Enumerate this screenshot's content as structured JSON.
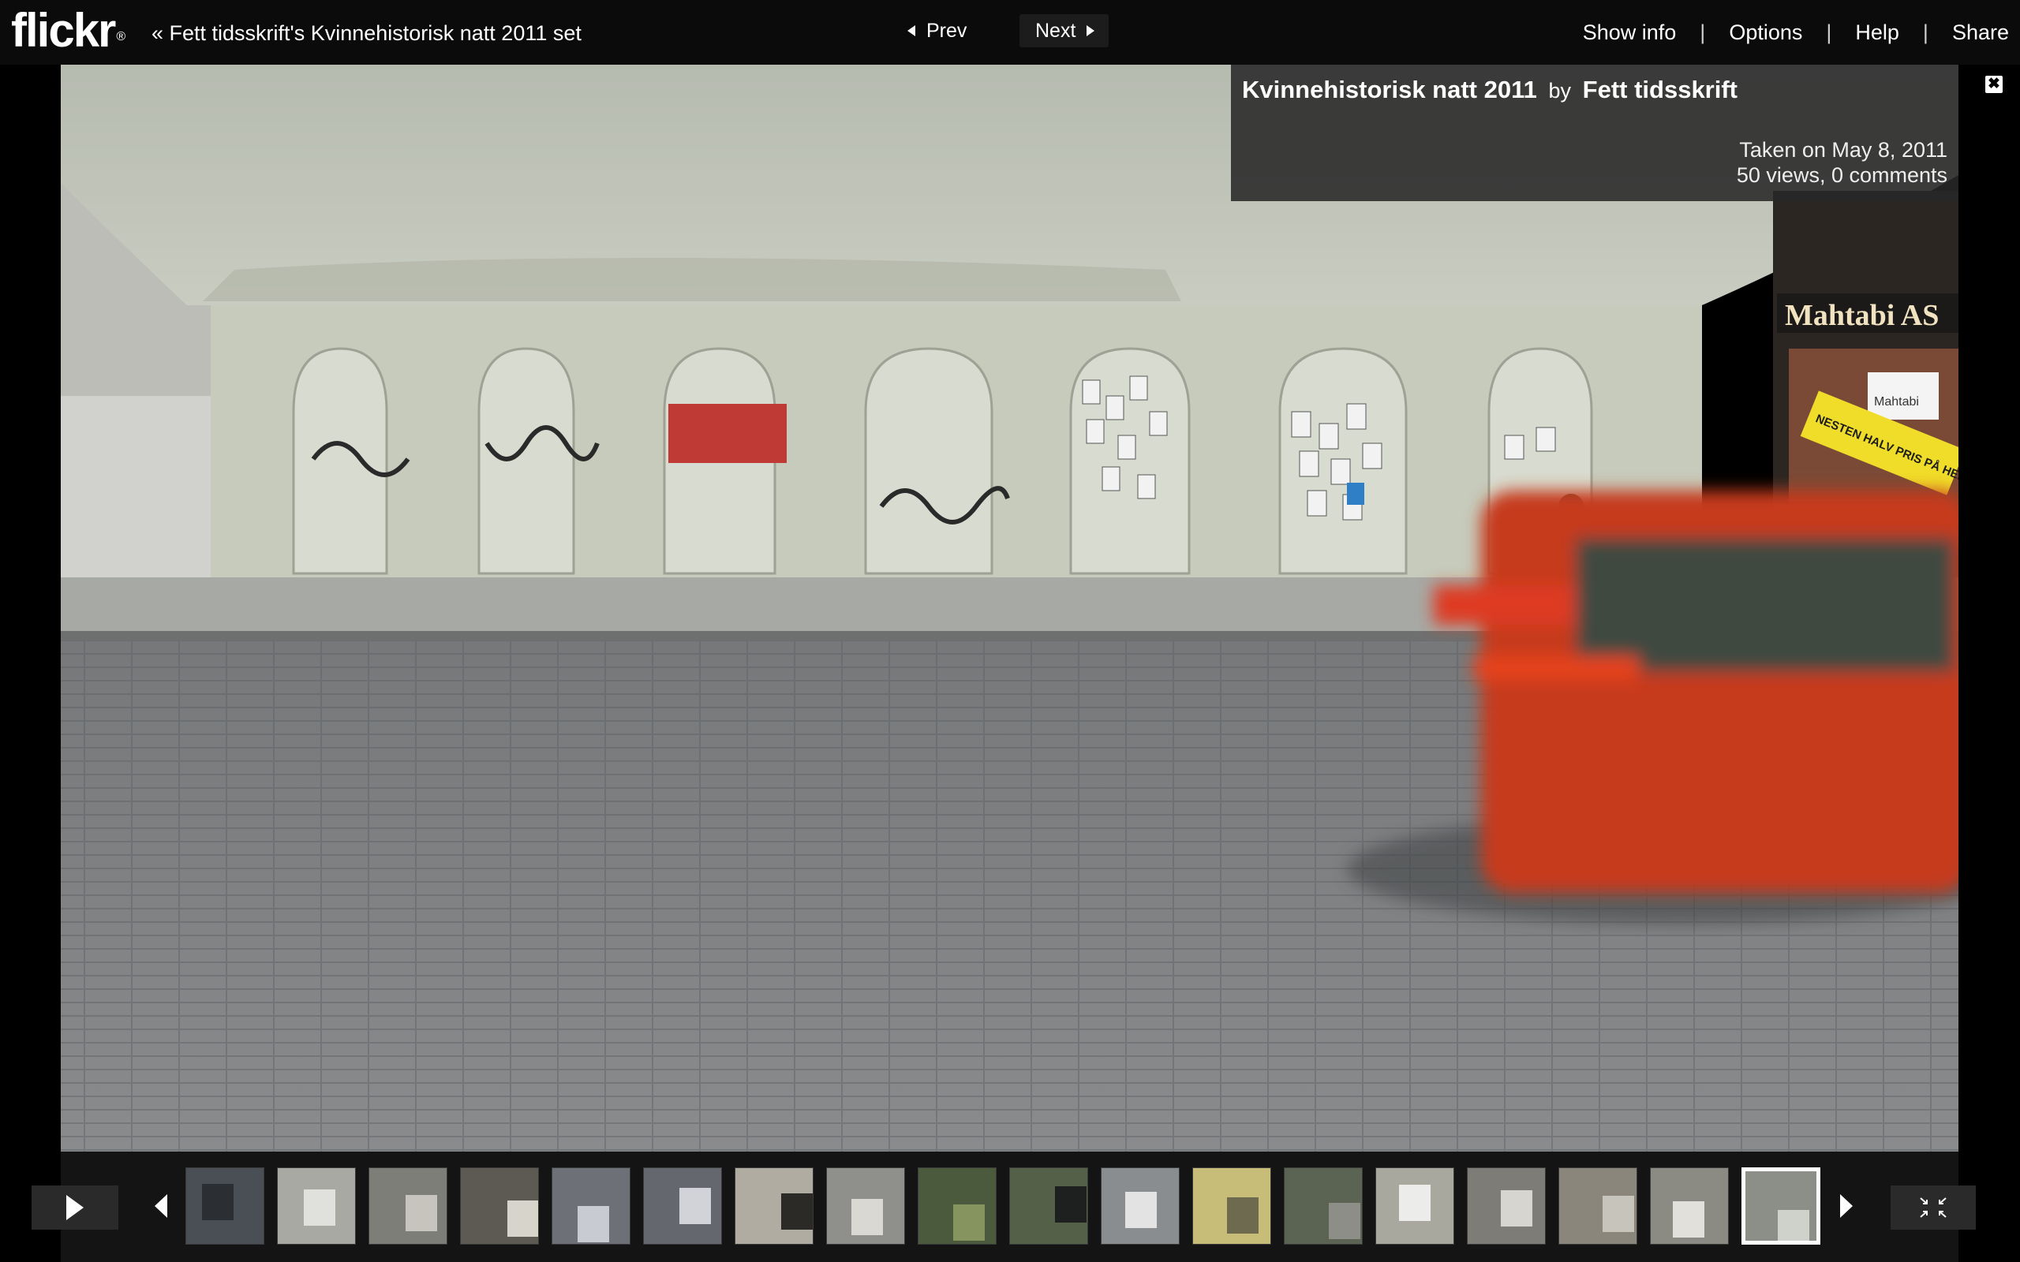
{
  "brand": {
    "logo": "flickr",
    "logo_mark": "®"
  },
  "header": {
    "back_link": "« Fett tidsskrift's Kvinnehistorisk natt 2011 set",
    "prev_label": "Prev",
    "next_label": "Next",
    "show_info_label": "Show info",
    "options_label": "Options",
    "help_label": "Help",
    "share_label": "Share",
    "separator": "|"
  },
  "info": {
    "title": "Kvinnehistorisk natt 2011",
    "by": "by",
    "author": "Fett tidsskrift",
    "taken": "Taken on May 8, 2011",
    "stats": "50 views, 0 comments",
    "close": "✖"
  },
  "photo": {
    "sign_shop": "Mahtabi AS",
    "sign_window": "Mahtabi",
    "yellow_sign": "NESTEN HALV PRIS PÅ HELE BUTIKKEN"
  },
  "filmstrip": {
    "thumbs": [
      {
        "bg": "#4a4e55",
        "fg": "#2b2e33"
      },
      {
        "bg": "#a9a9a4",
        "fg": "#e0e0dc"
      },
      {
        "bg": "#7e7e78",
        "fg": "#c6c4bd"
      },
      {
        "bg": "#5c5a52",
        "fg": "#d7d4cb"
      },
      {
        "bg": "#6e7078",
        "fg": "#c9cbd2"
      },
      {
        "bg": "#65676f",
        "fg": "#d2d3d8"
      },
      {
        "bg": "#b1aca2",
        "fg": "#2c2a26"
      },
      {
        "bg": "#8f908c",
        "fg": "#d9d8d2"
      },
      {
        "bg": "#4b5a3c",
        "fg": "#86955f"
      },
      {
        "bg": "#556048",
        "fg": "#1e1f1f"
      },
      {
        "bg": "#8a8d8f",
        "fg": "#e2e3e2"
      },
      {
        "bg": "#c7bd78",
        "fg": "#6d6a4f"
      },
      {
        "bg": "#5b6353",
        "fg": "#8e8e88"
      },
      {
        "bg": "#a9a89f",
        "fg": "#ececea"
      },
      {
        "bg": "#7d7c76",
        "fg": "#d6d5cf"
      },
      {
        "bg": "#8a867c",
        "fg": "#c7c4bc"
      },
      {
        "bg": "#8b8a83",
        "fg": "#e1e0db"
      },
      {
        "bg": "#8c8f88",
        "fg": "#cfd2cb"
      }
    ],
    "active_index": 17
  },
  "colors": {
    "bar_bg": "#0b0b0b",
    "panel_bg": "#282828",
    "car_red": "#c63a1f"
  }
}
